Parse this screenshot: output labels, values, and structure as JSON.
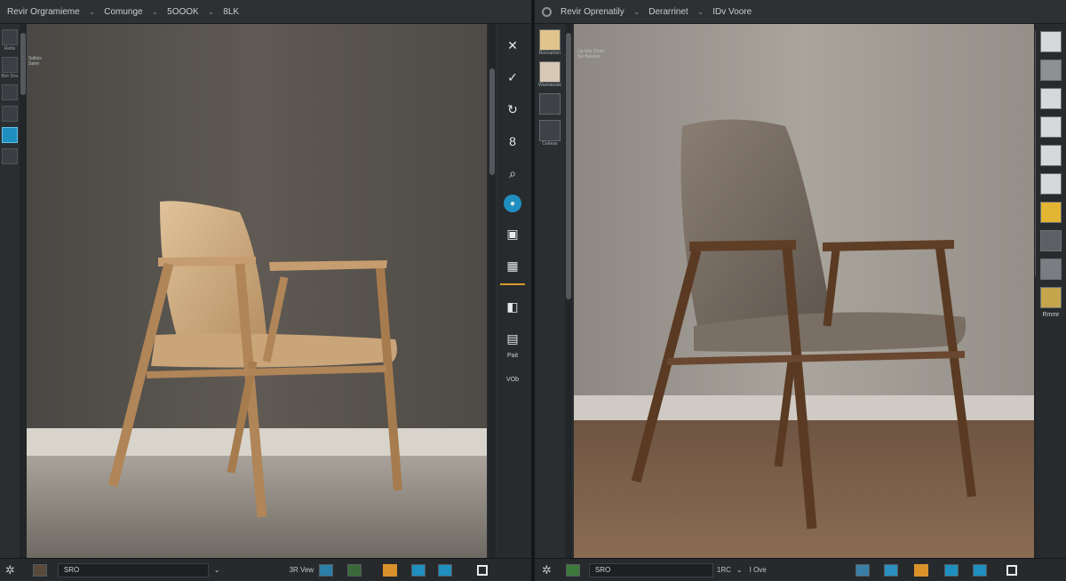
{
  "left": {
    "title": [
      "Revir Orgramieme",
      "Comunge",
      "5OOOK",
      "8LK"
    ],
    "sidebar_captions": [
      "Retlis",
      "Bvir Dos"
    ],
    "viewport_note": [
      "Solleis",
      "Sarer"
    ],
    "rtool_caption_1": "Pait",
    "rtool_caption_2": "VOb",
    "status": {
      "field": "SRO",
      "zoom": "3R Vew"
    }
  },
  "right": {
    "title": [
      "Revir Oprenatily",
      "Derarrinet",
      "IDv Voore"
    ],
    "thumb_captions": [
      "Beenamnn",
      "Waetiawate",
      "Celreas"
    ],
    "viewport_note": [
      "Lip bhe Crren",
      "Sw Beaove"
    ],
    "rpanel_caption": "Rmmr",
    "status": {
      "field": "SRO",
      "zoom": "1RC",
      "zoom_sub": "I Ove"
    }
  },
  "colors": {
    "accent": "#1f8fbf",
    "highlight": "#d99a2e",
    "panel": "#2a2d30"
  }
}
